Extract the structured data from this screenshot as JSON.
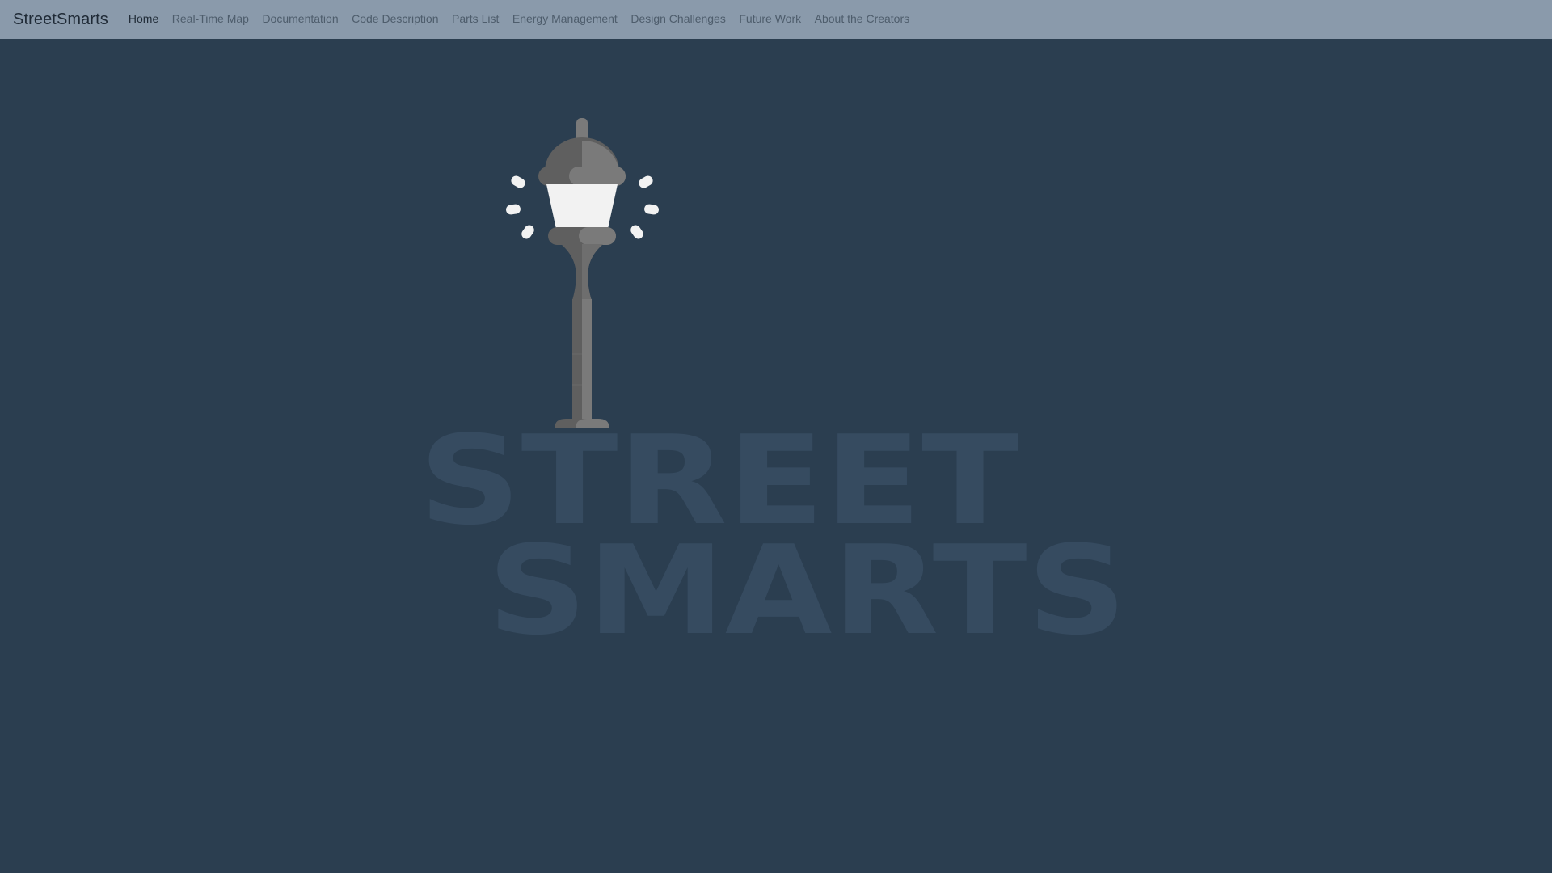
{
  "navbar": {
    "brand": "StreetSmarts",
    "links": [
      {
        "label": "Home",
        "active": true
      },
      {
        "label": "Real-Time Map",
        "active": false
      },
      {
        "label": "Documentation",
        "active": false
      },
      {
        "label": "Code Description",
        "active": false
      },
      {
        "label": "Parts List",
        "active": false
      },
      {
        "label": "Energy Management",
        "active": false
      },
      {
        "label": "Design Challenges",
        "active": false
      },
      {
        "label": "Future Work",
        "active": false
      },
      {
        "label": "About the Creators",
        "active": false
      }
    ]
  },
  "hero": {
    "logo_line1": "STREET",
    "logo_line2": "SMARTS",
    "icon": "street-lamp-icon"
  },
  "colors": {
    "background": "#2b3e50",
    "navbar": "#8a9aab",
    "logo_text": "#364b60",
    "lamp_dark": "#5f5f5f",
    "lamp_light": "#7a7a7a",
    "lamp_glass": "#f2f2f2"
  }
}
